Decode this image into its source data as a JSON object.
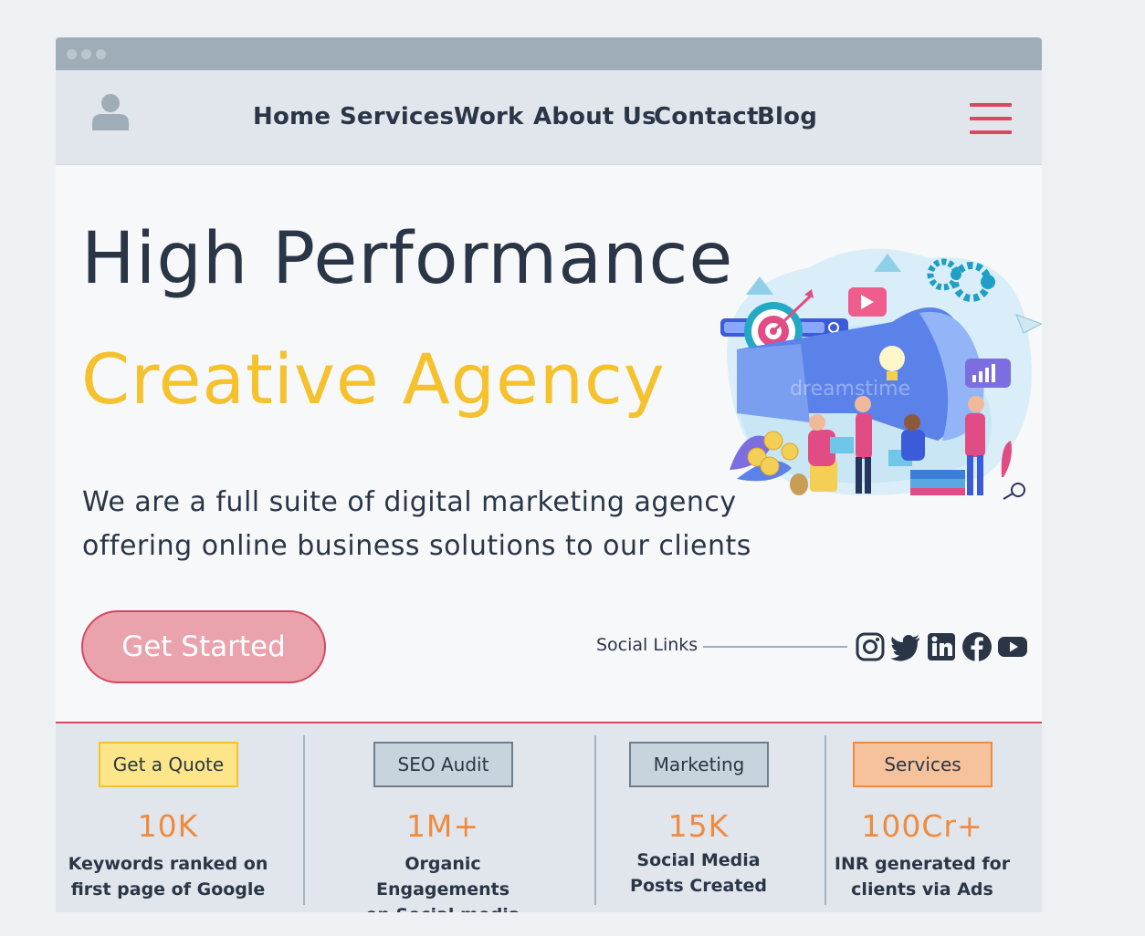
{
  "nav": {
    "items": [
      {
        "label": "Home"
      },
      {
        "label": "Services"
      },
      {
        "label": "Work"
      },
      {
        "label": "About Us"
      },
      {
        "label": "Contact"
      },
      {
        "label": "Blog"
      }
    ]
  },
  "hero": {
    "title": "High Performance",
    "accent": "Creative Agency",
    "description": "We are a full suite of digital marketing agency offering online business solutions to our clients",
    "cta_label": "Get Started",
    "illustration_watermark": "dreamstime"
  },
  "social": {
    "label": "Social Links",
    "icons": [
      "instagram-icon",
      "twitter-icon",
      "linkedin-icon",
      "facebook-icon",
      "youtube-icon"
    ]
  },
  "stats": [
    {
      "tag": "Get a Quote",
      "value": "10K",
      "line1": "Keywords ranked on",
      "line2": "first page of Google"
    },
    {
      "tag": "SEO Audit",
      "value": "1M+",
      "line1": "Organic Engagements",
      "line2": "on Social media"
    },
    {
      "tag": "Marketing",
      "value": "15K",
      "line1": "Social Media",
      "line2": "Posts Created"
    },
    {
      "tag": "Services",
      "value": "100Cr+",
      "line1": "INR generated for",
      "line2": "clients via Ads"
    }
  ],
  "colors": {
    "page_bg": "#eef1f4",
    "titlebar": "#9fadb9",
    "navbar": "#e1e6ed",
    "text": "#2a3646",
    "accent_yellow": "#f5c12c",
    "accent_red": "#d9485f",
    "stat_orange": "#ef8a3e",
    "tag_quote": "#fde58a",
    "tag_seo": "#c7d3dd",
    "tag_marketing": "#c7d3dd",
    "tag_services": "#f5c29b"
  }
}
